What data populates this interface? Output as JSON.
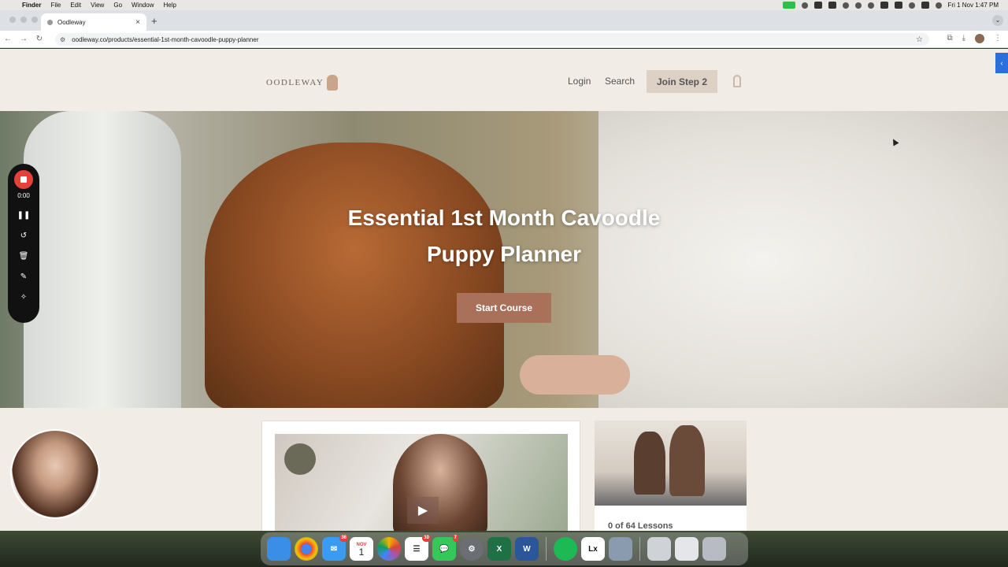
{
  "menubar": {
    "app": "Finder",
    "items": [
      "File",
      "Edit",
      "View",
      "Go",
      "Window",
      "Help"
    ],
    "clock": "Fri 1 Nov  1:47 PM"
  },
  "browser": {
    "tab_title": "Oodleway",
    "url": "oodleway.co/products/essential-1st-month-cavoodle-puppy-planner"
  },
  "site": {
    "logo": "OODLEWAY",
    "nav": {
      "login": "Login",
      "search": "Search",
      "join": "Join Step 2"
    }
  },
  "hero": {
    "title_line1": "Essential 1st Month Cavoodle",
    "title_line2": "Puppy Planner",
    "cta": "Start Course"
  },
  "course": {
    "lessons": "0 of 64 Lessons"
  },
  "recorder": {
    "time": "0:00"
  },
  "dock": {
    "mail_badge": "36",
    "calendar_month": "NOV",
    "calendar_day": "1",
    "reminders_badge": "10",
    "messages_badge": "7"
  }
}
